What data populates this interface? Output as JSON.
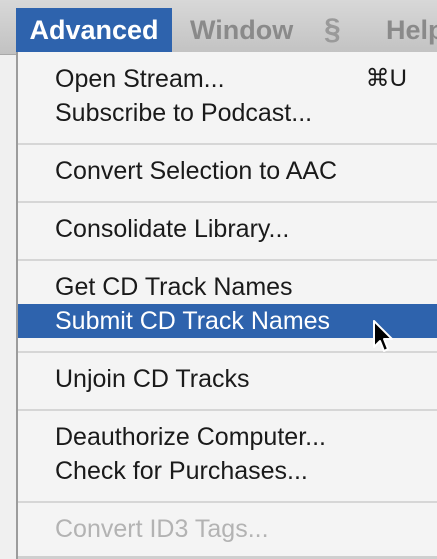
{
  "menubar": {
    "items": [
      {
        "label": "Advanced"
      },
      {
        "label": "Window"
      },
      {
        "label": "§"
      },
      {
        "label": "Help"
      }
    ]
  },
  "menu": {
    "items": [
      {
        "label": "Open Stream...",
        "shortcut": "⌘U"
      },
      {
        "label": "Subscribe to Podcast..."
      },
      {
        "label": "Convert Selection to AAC"
      },
      {
        "label": "Consolidate Library..."
      },
      {
        "label": "Get CD Track Names"
      },
      {
        "label": "Submit CD Track Names"
      },
      {
        "label": "Unjoin CD Tracks"
      },
      {
        "label": "Deauthorize Computer..."
      },
      {
        "label": "Check for Purchases..."
      },
      {
        "label": "Convert ID3 Tags..."
      }
    ]
  },
  "colors": {
    "highlight": "#2e63ad",
    "disabled": "#b3b3b3",
    "menubar": "#c8c8c8"
  },
  "icons": {
    "cursor": "arrow-cursor-icon",
    "script": "script-menu-icon"
  }
}
